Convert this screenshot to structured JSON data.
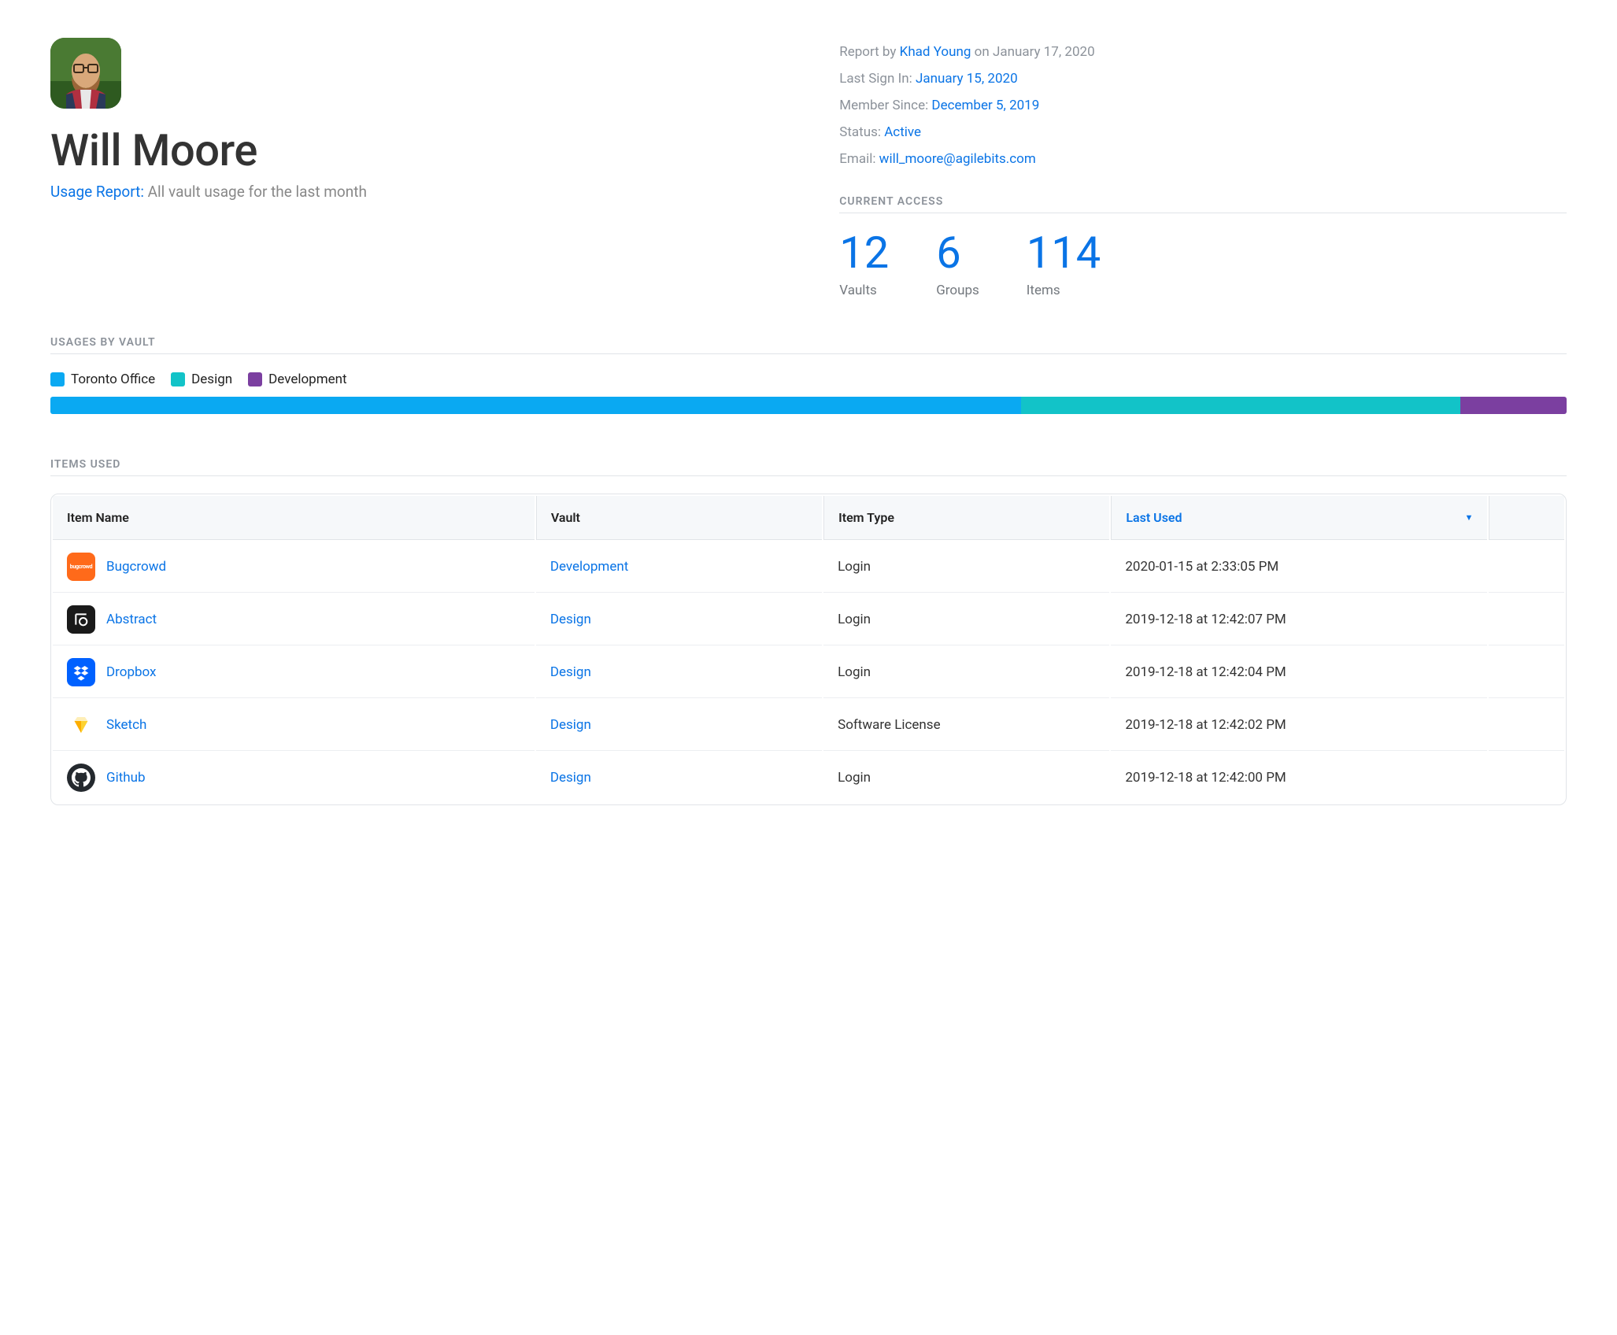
{
  "profile": {
    "name": "Will Moore",
    "subtitle_label": "Usage Report:",
    "subtitle_desc": "All vault usage for the last month"
  },
  "meta": {
    "report_by_label": "Report by",
    "report_by_value": "Khad Young",
    "report_by_on": "on January 17, 2020",
    "last_signin_label": "Last Sign In:",
    "last_signin_value": "January 15, 2020",
    "member_since_label": "Member Since:",
    "member_since_value": "December 5, 2019",
    "status_label": "Status:",
    "status_value": "Active",
    "email_label": "Email:",
    "email_value": "will_moore@agilebits.com"
  },
  "access": {
    "heading": "Current Access",
    "vaults_num": "12",
    "vaults_label": "Vaults",
    "groups_num": "6",
    "groups_label": "Groups",
    "items_num": "114",
    "items_label": "Items"
  },
  "usages": {
    "heading": "Usages by Vault",
    "legend": [
      {
        "label": "Toronto Office",
        "color": "#0aa9f2"
      },
      {
        "label": "Design",
        "color": "#12c3c8"
      },
      {
        "label": "Development",
        "color": "#7b3fa0"
      }
    ]
  },
  "items_used": {
    "heading": "Items Used",
    "columns": {
      "name": "Item Name",
      "vault": "Vault",
      "type": "Item Type",
      "last_used": "Last Used"
    },
    "rows": [
      {
        "name": "Bugcrowd",
        "vault": "Development",
        "type": "Login",
        "last_used": "2020-01-15 at 2:33:05 PM",
        "icon": "bugcrowd"
      },
      {
        "name": "Abstract",
        "vault": "Design",
        "type": "Login",
        "last_used": "2019-12-18 at 12:42:07 PM",
        "icon": "abstract"
      },
      {
        "name": "Dropbox",
        "vault": "Design",
        "type": "Login",
        "last_used": "2019-12-18 at 12:42:04 PM",
        "icon": "dropbox"
      },
      {
        "name": "Sketch",
        "vault": "Design",
        "type": "Software License",
        "last_used": "2019-12-18 at 12:42:02 PM",
        "icon": "sketch"
      },
      {
        "name": "Github",
        "vault": "Design",
        "type": "Login",
        "last_used": "2019-12-18 at 12:42:00 PM",
        "icon": "github"
      }
    ]
  },
  "chart_data": {
    "type": "bar",
    "categories": [
      "Toronto Office",
      "Design",
      "Development"
    ],
    "values": [
      64,
      29,
      7
    ],
    "title": "Usages by Vault",
    "xlabel": "",
    "ylabel": "",
    "ylim": [
      0,
      100
    ],
    "colors": [
      "#0aa9f2",
      "#12c3c8",
      "#7b3fa0"
    ]
  }
}
